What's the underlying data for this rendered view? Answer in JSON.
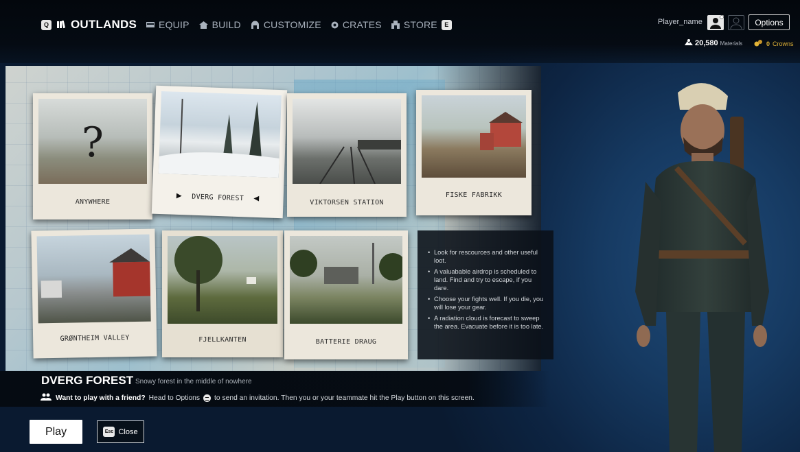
{
  "nav": {
    "left_key": "Q",
    "items": [
      {
        "label": "OUTLANDS",
        "icon": "map-book-icon",
        "active": true
      },
      {
        "label": "EQUIP",
        "icon": "backpack-icon",
        "active": false
      },
      {
        "label": "BUILD",
        "icon": "house-icon",
        "active": false
      },
      {
        "label": "CUSTOMIZE",
        "icon": "hood-icon",
        "active": false
      },
      {
        "label": "CRATES",
        "icon": "crate-icon",
        "active": false
      },
      {
        "label": "STORE",
        "icon": "store-icon",
        "active": false
      }
    ],
    "right_key": "E"
  },
  "account": {
    "player_name": "Player_name",
    "options_label": "Options",
    "materials_value": "20,580",
    "materials_label": "Materials",
    "crowns_value": "0",
    "crowns_label": "Crowns"
  },
  "locations": [
    {
      "name": "ANYWHERE",
      "selected": false
    },
    {
      "name": "DVERG FOREST",
      "selected": true
    },
    {
      "name": "VIKTORSEN STATION",
      "selected": false
    },
    {
      "name": "FISKE FABRIKK",
      "selected": false
    },
    {
      "name": "GRØNTHEIM VALLEY",
      "selected": false
    },
    {
      "name": "FJELLKANTEN",
      "selected": false
    },
    {
      "name": "BATTERIE DRAUG",
      "selected": false
    }
  ],
  "tips": [
    "Look for rescources and other useful loot.",
    "A valuabable airdrop is scheduled to land. Find and try to escape, if you dare.",
    "Choose your fights well. If you die, you will lose your gear.",
    "A radiation cloud is forecast to sweep the area. Evacuate before it is too late."
  ],
  "selected_location": {
    "title": "DVERG FOREST",
    "subtitle": "Snowy forest in the middle of nowhere"
  },
  "friend_hint": {
    "bold": "Want to play with a friend?",
    "before_icon": "Head to Options",
    "after_icon": "to send an invitation. Then you or your teammate hit the Play button on this screen."
  },
  "buttons": {
    "play_label": "Play",
    "close_key": "Esc",
    "close_label": "Close"
  },
  "colors": {
    "accent_gold": "#e2b437",
    "card_paper": "#ece7dc",
    "background_blue": "#163a62"
  }
}
